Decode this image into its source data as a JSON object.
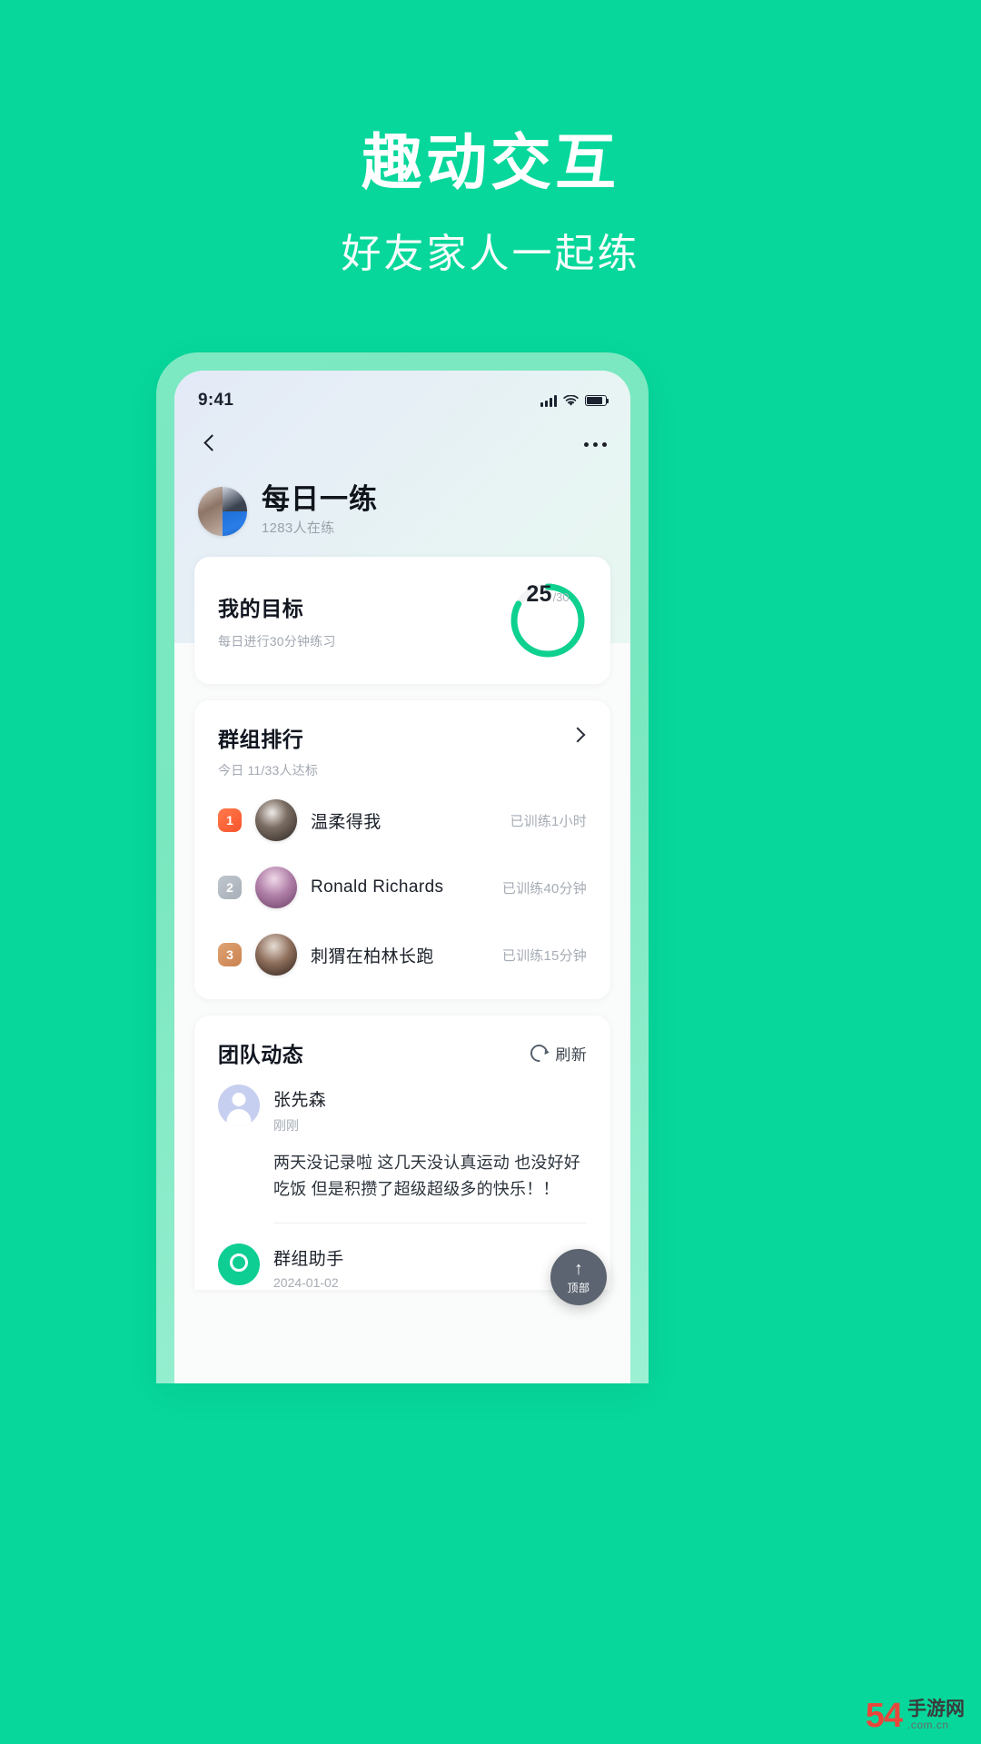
{
  "promo": {
    "title": "趣动交互",
    "subtitle": "好友家人一起练"
  },
  "phone": {
    "statusbar": {
      "time": "9:41"
    },
    "navbar": {
      "back": "‹",
      "more": "···"
    },
    "group": {
      "name": "每日一练",
      "members": "1283人在练"
    },
    "goal": {
      "title": "我的目标",
      "subtitle": "每日进行30分钟练习",
      "value": "25",
      "denominator": "/30",
      "percent": 83,
      "accent": "#0ED18F"
    },
    "rank": {
      "title": "群组排行",
      "subtitle": "今日 11/33人达标",
      "rows": [
        {
          "rank": "1",
          "name": "温柔得我",
          "meta": "已训练1小时"
        },
        {
          "rank": "2",
          "name": "Ronald Richards",
          "meta": "已训练40分钟"
        },
        {
          "rank": "3",
          "name": "刺猬在柏林长跑",
          "meta": "已训练15分钟"
        }
      ]
    },
    "feed": {
      "title": "团队动态",
      "refresh": "刷新",
      "posts": [
        {
          "name": "张先森",
          "time": "刚刚",
          "body": "两天没记录啦 这几天没认真运动 也没好好吃饭 但是积攒了超级超级多的快乐！！"
        },
        {
          "name": "群组助手",
          "time": "2024-01-02",
          "body": ""
        }
      ]
    },
    "fab": {
      "arrow": "↑",
      "label": "顶部"
    }
  },
  "watermark": {
    "number": "54",
    "line1": "手游网",
    "line2": ".com.cn"
  }
}
